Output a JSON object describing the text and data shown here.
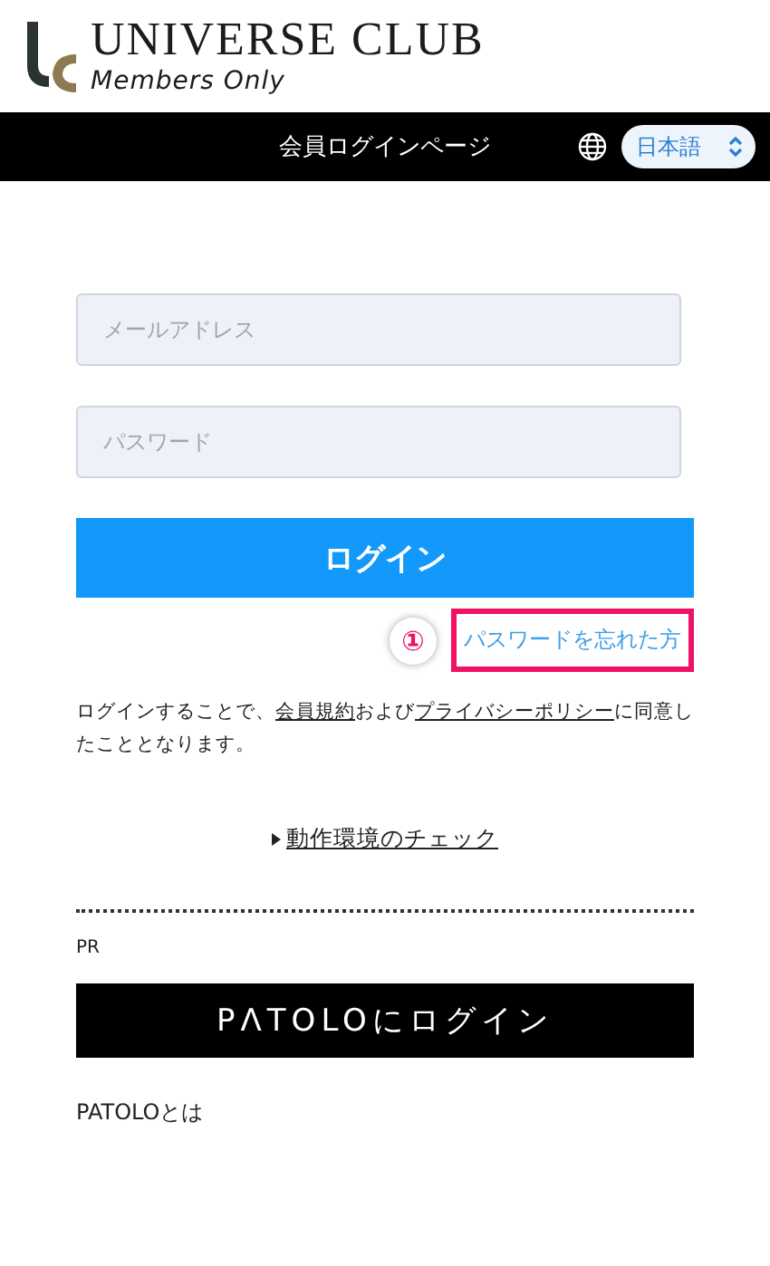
{
  "logo": {
    "title": "UNIVERSE CLUB",
    "subtitle": "Members Only"
  },
  "header_bar": {
    "title": "会員ログインページ",
    "language": "日本語"
  },
  "form": {
    "email": {
      "placeholder": "メールアドレス"
    },
    "password": {
      "placeholder": "パスワード"
    },
    "login_button": "ログイン"
  },
  "forgot_password": {
    "label": "パスワードを忘れた方",
    "marker": "①",
    "highlighted": true
  },
  "terms": {
    "before": "ログインすることで、",
    "link1": "会員規約",
    "middle": "および",
    "link2": "プライバシーポリシー",
    "after": "に同意したこととなります。"
  },
  "environment_check": {
    "label": "動作環境のチェック"
  },
  "pr": {
    "label": "PR",
    "button": "PΛTOLOにログイン",
    "about": "PATOLOとは"
  }
}
